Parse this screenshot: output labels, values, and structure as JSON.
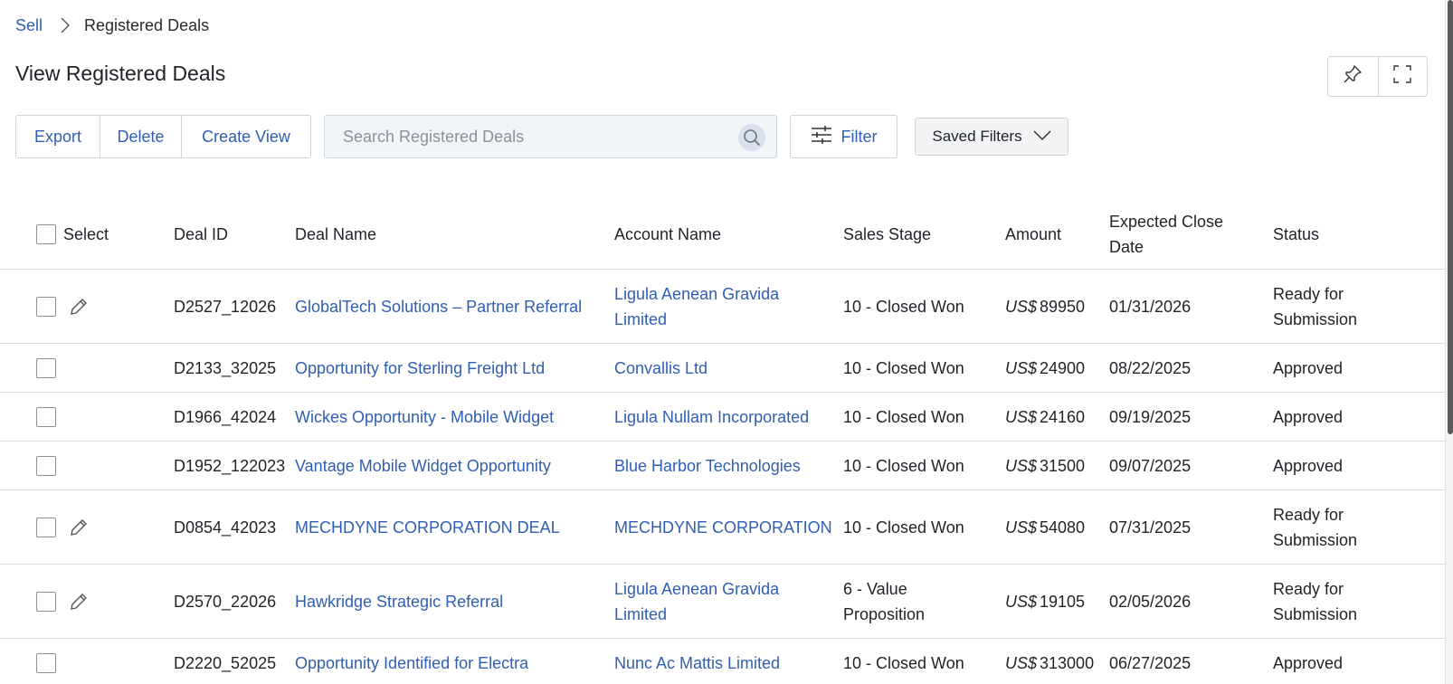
{
  "breadcrumb": {
    "parent": "Sell",
    "current": "Registered Deals"
  },
  "page_title": "View Registered Deals",
  "toolbar": {
    "export_label": "Export",
    "delete_label": "Delete",
    "create_view_label": "Create View",
    "filter_label": "Filter",
    "saved_filters_label": "Saved Filters"
  },
  "search": {
    "placeholder": "Search Registered Deals",
    "value": ""
  },
  "table": {
    "headers": {
      "select": "Select",
      "deal_id": "Deal ID",
      "deal_name": "Deal Name",
      "account_name": "Account Name",
      "sales_stage": "Sales Stage",
      "amount": "Amount",
      "expected_close_line1": "Expected Close",
      "expected_close_line2": "Date",
      "status": "Status"
    },
    "rows": [
      {
        "deal_id": "D2527_12026",
        "deal_name": "GlobalTech Solutions – Partner Referral",
        "account_l1": "Ligula Aenean Gravida",
        "account_l2": "Limited",
        "stage_l1": "10 - Closed Won",
        "stage_l2": "",
        "currency": "US$",
        "amount": "89950",
        "close_date": "01/31/2026",
        "status_l1": "Ready for",
        "status_l2": "Submission",
        "editable": true
      },
      {
        "deal_id": "D2133_32025",
        "deal_name": "Opportunity for Sterling Freight Ltd",
        "account_l1": "Convallis Ltd",
        "account_l2": "",
        "stage_l1": "10 - Closed Won",
        "stage_l2": "",
        "currency": "US$",
        "amount": "24900",
        "close_date": "08/22/2025",
        "status_l1": "Approved",
        "status_l2": "",
        "editable": false
      },
      {
        "deal_id": "D1966_42024",
        "deal_name": "Wickes Opportunity - Mobile Widget",
        "account_l1": "Ligula Nullam Incorporated",
        "account_l2": "",
        "stage_l1": "10 - Closed Won",
        "stage_l2": "",
        "currency": "US$",
        "amount": "24160",
        "close_date": "09/19/2025",
        "status_l1": "Approved",
        "status_l2": "",
        "editable": false
      },
      {
        "deal_id": "D1952_122023",
        "deal_name": "Vantage Mobile Widget Opportunity",
        "account_l1": "Blue Harbor Technologies",
        "account_l2": "",
        "stage_l1": "10 - Closed Won",
        "stage_l2": "",
        "currency": "US$",
        "amount": "31500",
        "close_date": "09/07/2025",
        "status_l1": "Approved",
        "status_l2": "",
        "editable": false
      },
      {
        "deal_id": "D0854_42023",
        "deal_name": "MECHDYNE CORPORATION DEAL",
        "account_l1": "MECHDYNE CORPORATION",
        "account_l2": "",
        "stage_l1": "10 - Closed Won",
        "stage_l2": "",
        "currency": "US$",
        "amount": "54080",
        "close_date": "07/31/2025",
        "status_l1": "Ready for",
        "status_l2": "Submission",
        "editable": true
      },
      {
        "deal_id": "D2570_22026",
        "deal_name": "Hawkridge Strategic Referral",
        "account_l1": "Ligula Aenean Gravida",
        "account_l2": "Limited",
        "stage_l1": "6 - Value",
        "stage_l2": "Proposition",
        "currency": "US$",
        "amount": "19105",
        "close_date": "02/05/2026",
        "status_l1": "Ready for",
        "status_l2": "Submission",
        "editable": true
      },
      {
        "deal_id": "D2220_52025",
        "deal_name": "Opportunity Identified for Electra",
        "account_l1": "Nunc Ac Mattis Limited",
        "account_l2": "",
        "stage_l1": "10 - Closed Won",
        "stage_l2": "",
        "currency": "US$",
        "amount": "313000",
        "close_date": "06/27/2025",
        "status_l1": "Approved",
        "status_l2": "",
        "editable": false
      }
    ]
  },
  "icons": {
    "breadcrumb_sep": "chevron-right-icon",
    "pin": "pin-icon",
    "fullscreen": "fullscreen-icon",
    "search": "search-icon",
    "filter": "sliders-icon",
    "saved_filters": "chevron-down-icon",
    "edit": "pencil-icon"
  },
  "colors": {
    "link": "#2f5fb3",
    "border": "#cfd3d8",
    "search_bg": "#f1f4f8",
    "text": "#1f2328"
  }
}
